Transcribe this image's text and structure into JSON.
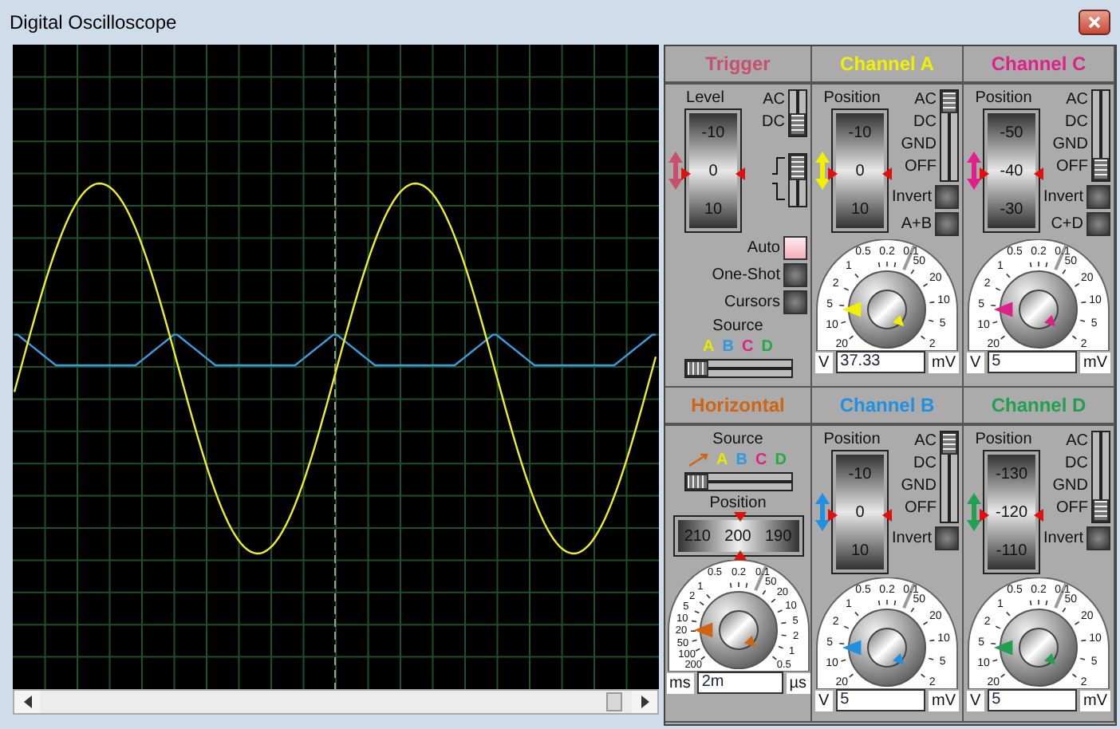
{
  "window": {
    "title": "Digital Oscilloscope"
  },
  "panels": [
    {
      "kind": "trigger",
      "title": "Trigger",
      "color": "#c8506c",
      "level_label": "Level",
      "scale": [
        "-10",
        "0",
        "10"
      ],
      "coupling": [
        {
          "label": "AC",
          "selected": false
        },
        {
          "label": "DC",
          "selected": true
        }
      ],
      "edges": [
        {
          "kind": "rising",
          "selected": true
        },
        {
          "kind": "falling",
          "selected": false
        }
      ],
      "buttons": [
        {
          "label": "Auto",
          "on": true
        },
        {
          "label": "One-Shot",
          "on": false
        },
        {
          "label": "Cursors",
          "on": false
        }
      ],
      "source_label": "Source",
      "sources": [
        {
          "label": "A",
          "color": "#e8e800"
        },
        {
          "label": "B",
          "color": "#3399dd"
        },
        {
          "label": "C",
          "color": "#dd2288"
        },
        {
          "label": "D",
          "color": "#22aa44"
        }
      ],
      "source_slider": {
        "level": 0
      }
    },
    {
      "kind": "channel",
      "title": "Channel A",
      "color": "#f0f000",
      "position_label": "Position",
      "scale": [
        "-10",
        "0",
        "10"
      ],
      "coupling": [
        {
          "label": "AC",
          "selected": true
        },
        {
          "label": "DC",
          "selected": false
        },
        {
          "label": "GND",
          "selected": false
        },
        {
          "label": "OFF",
          "selected": false
        }
      ],
      "buttons": [
        {
          "label": "Invert",
          "on": false
        },
        {
          "label": "A+B",
          "on": false
        }
      ],
      "dial": {
        "left_scale": [
          "0.5",
          "0.2",
          "0.1",
          "1",
          "2",
          "5",
          "10",
          "20"
        ],
        "right_scale": [
          "50",
          "20",
          "10",
          "5",
          "2"
        ],
        "left_unit": "V",
        "right_unit": "mV",
        "value": "37.33"
      }
    },
    {
      "kind": "channel",
      "title": "Channel C",
      "color": "#e0208a",
      "position_label": "Position",
      "scale": [
        "-50",
        "-40",
        "-30"
      ],
      "coupling": [
        {
          "label": "AC",
          "selected": false
        },
        {
          "label": "DC",
          "selected": false
        },
        {
          "label": "GND",
          "selected": false
        },
        {
          "label": "OFF",
          "selected": true
        }
      ],
      "buttons": [
        {
          "label": "Invert",
          "on": false
        },
        {
          "label": "C+D",
          "on": false
        }
      ],
      "dial": {
        "left_scale": [
          "0.5",
          "0.2",
          "0.1",
          "1",
          "2",
          "5",
          "10",
          "20"
        ],
        "right_scale": [
          "50",
          "20",
          "10",
          "5",
          "2"
        ],
        "left_unit": "V",
        "right_unit": "mV",
        "value": "5"
      }
    },
    {
      "kind": "horizontal",
      "title": "Horizontal",
      "color": "#d06410",
      "source_label": "Source",
      "sources": [
        {
          "label": "A",
          "color": "#e8e800"
        },
        {
          "label": "B",
          "color": "#3399dd"
        },
        {
          "label": "C",
          "color": "#dd2288"
        },
        {
          "label": "D",
          "color": "#22aa44"
        }
      ],
      "source_slider": {
        "level": 0
      },
      "position_label": "Position",
      "scale": [
        "210",
        "200",
        "190"
      ],
      "dial": {
        "left_scale": [
          "0.5",
          "0.2",
          "0.1",
          "1",
          "2",
          "5",
          "10",
          "20",
          "50",
          "100",
          "200"
        ],
        "right_scale": [
          "50",
          "20",
          "10",
          "5",
          "2",
          "1",
          "0.5"
        ],
        "left_unit": "ms",
        "right_unit": "µs",
        "value": "2m"
      }
    },
    {
      "kind": "channel",
      "title": "Channel B",
      "color": "#2090e0",
      "position_label": "Position",
      "scale": [
        "-10",
        "0",
        "10"
      ],
      "coupling": [
        {
          "label": "AC",
          "selected": true
        },
        {
          "label": "DC",
          "selected": false
        },
        {
          "label": "GND",
          "selected": false
        },
        {
          "label": "OFF",
          "selected": false
        }
      ],
      "buttons": [
        {
          "label": "Invert",
          "on": false
        }
      ],
      "dial": {
        "left_scale": [
          "0.5",
          "0.2",
          "0.1",
          "1",
          "2",
          "5",
          "10",
          "20"
        ],
        "right_scale": [
          "50",
          "20",
          "10",
          "5",
          "2"
        ],
        "left_unit": "V",
        "right_unit": "mV",
        "value": "5"
      }
    },
    {
      "kind": "channel",
      "title": "Channel D",
      "color": "#20a050",
      "position_label": "Position",
      "scale": [
        "-130",
        "-120",
        "-110"
      ],
      "coupling": [
        {
          "label": "AC",
          "selected": false
        },
        {
          "label": "DC",
          "selected": false
        },
        {
          "label": "GND",
          "selected": false
        },
        {
          "label": "OFF",
          "selected": true
        }
      ],
      "buttons": [
        {
          "label": "Invert",
          "on": false
        }
      ],
      "dial": {
        "left_scale": [
          "0.5",
          "0.2",
          "0.1",
          "1",
          "2",
          "5",
          "10",
          "20"
        ],
        "right_scale": [
          "50",
          "20",
          "10",
          "5",
          "2"
        ],
        "left_unit": "V",
        "right_unit": "mV",
        "value": "5"
      }
    }
  ]
}
